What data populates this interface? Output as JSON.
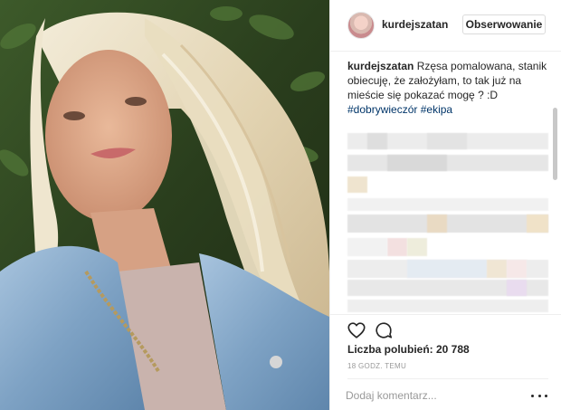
{
  "post": {
    "username": "kurdejszatan",
    "follow_label": "Obserwowanie",
    "caption_user": "kurdejszatan",
    "caption_text": "Rzęsa pomalowana, stanik obiecuję, że założyłam, to tak już na mieście się pokazać mogę ? :D",
    "hashtag_1": "#dobrywieczór",
    "hashtag_2": "#ekipa",
    "likes": "Liczba polubień: 20 788",
    "timestamp": "18 GODZ. TEMU",
    "comment_placeholder": "Dodaj komentarz..."
  },
  "icons": {
    "heart": "heart-icon",
    "comment": "comment-icon",
    "more": "more-icon",
    "avatar": "avatar"
  },
  "colors": {
    "hashtag": "#003569",
    "text": "#262626",
    "muted": "#999999",
    "border": "#efefef"
  }
}
